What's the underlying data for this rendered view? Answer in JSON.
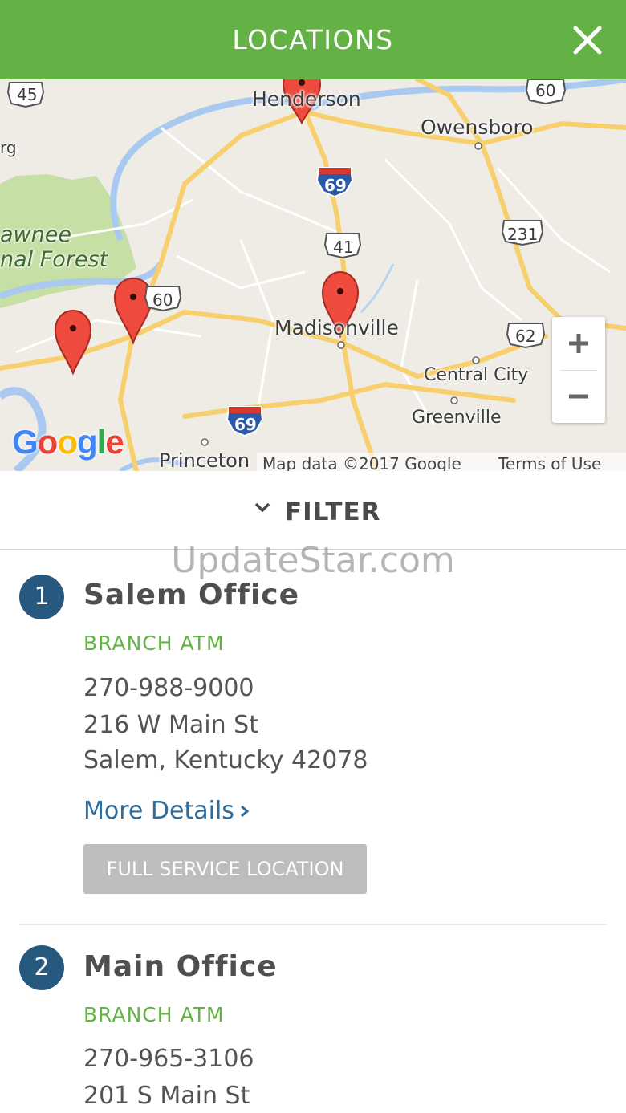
{
  "header": {
    "title": "LOCATIONS",
    "close_icon": "close-icon"
  },
  "map": {
    "labels": {
      "henderson": "Henderson",
      "owensboro": "Owensboro",
      "madisonville": "Madisonville",
      "central_city": "Central City",
      "greenville": "Greenville",
      "princeton": "Princeton",
      "forest_line1": "awnee",
      "forest_line2": "nal Forest",
      "rg": "rg"
    },
    "shields": {
      "us45": "45",
      "us60_top": "60",
      "i69_top": "69",
      "us41": "41",
      "us231": "231",
      "us60_left": "60",
      "us62": "62",
      "i69_bottom": "69"
    },
    "logo": "Google",
    "attribution": {
      "map_data": "Map data ©2017 Google",
      "terms": "Terms of Use"
    },
    "zoom": {
      "in_icon": "plus-icon",
      "out_icon": "minus-icon"
    },
    "colors": {
      "pin": "#ee4a3d",
      "forest": "#c6dfa5",
      "water": "#a9c9f1",
      "road": "#f7cf6d"
    }
  },
  "filter": {
    "label": "FILTER",
    "icon": "chevron-down-icon"
  },
  "watermark": "UpdateStar.com",
  "locations": [
    {
      "number": "1",
      "name": "Salem Office",
      "type": "BRANCH  ATM",
      "phone": "270-988-9000",
      "address1": "216 W Main St",
      "address2": "Salem, Kentucky 42078",
      "more": "More Details",
      "service": "FULL SERVICE LOCATION"
    },
    {
      "number": "2",
      "name": "Main Office",
      "type": "BRANCH  ATM",
      "phone": "270-965-3106",
      "address1": "201 S Main St"
    }
  ],
  "colors": {
    "header": "#64b245",
    "accent_green": "#64b245",
    "badge_blue": "#27597f",
    "link_blue": "#2e6c9c",
    "button_gray": "#bdbdbd"
  }
}
